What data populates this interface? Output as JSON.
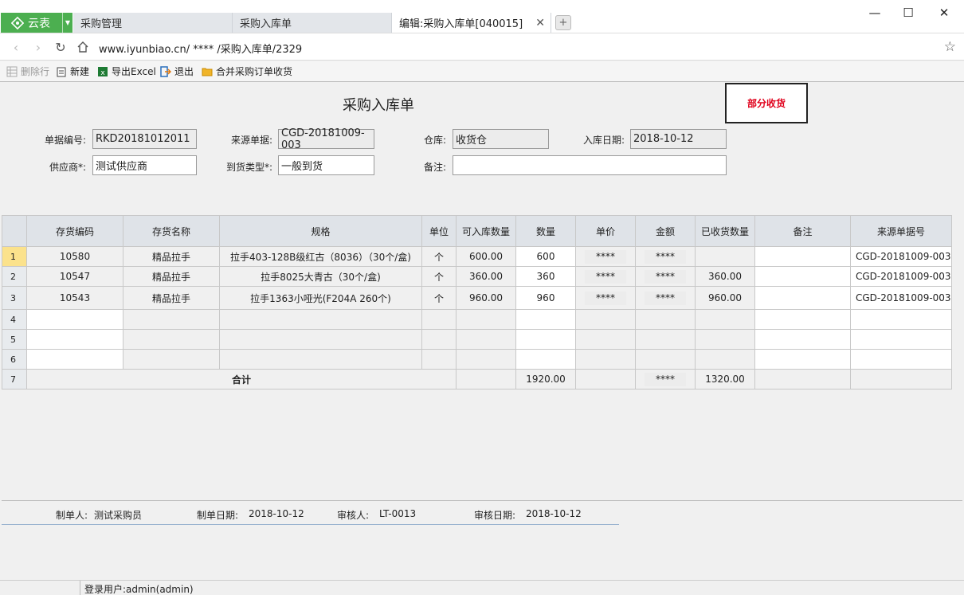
{
  "app": {
    "name": "云表"
  },
  "tabs": [
    {
      "label": "采购管理"
    },
    {
      "label": "采购入库单"
    },
    {
      "label": "编辑:采购入库单[040015]"
    }
  ],
  "window": {
    "min": "—",
    "max": "☐",
    "close": "✕"
  },
  "address": {
    "url": "www.iyunbiao.cn/ **** /采购入库单/2329"
  },
  "toolbar": {
    "delete_row": "删除行",
    "new": "新建",
    "export_excel": "导出Excel",
    "exit": "退出",
    "merge_receive": "合并采购订单收货"
  },
  "form": {
    "title": "采购入库单",
    "status": "部分收货",
    "doc_no_label": "单据编号:",
    "doc_no": "RKD20181012011",
    "source_label": "来源单据:",
    "source": "CGD-20181009-003",
    "warehouse_label": "仓库:",
    "warehouse": "收货仓",
    "date_label": "入库日期:",
    "date": "2018-10-12",
    "supplier_label": "供应商*:",
    "supplier": "测试供应商",
    "arrival_type_label": "到货类型*:",
    "arrival_type": "一般到货",
    "remark_label": "备注:",
    "remark": ""
  },
  "grid": {
    "headers": [
      "存货编码",
      "存货名称",
      "规格",
      "单位",
      "可入库数量",
      "数量",
      "单价",
      "金额",
      "已收货数量",
      "备注",
      "来源单据号"
    ],
    "rows": [
      {
        "n": "1",
        "code": "10580",
        "name": "精品拉手",
        "spec": "拉手403-128B级红古（8036）（30个/盒)",
        "unit": "个",
        "avail": "600.00",
        "qty": "600",
        "price": "****",
        "amount": "****",
        "received": "",
        "remark": "",
        "src": "CGD-20181009-003"
      },
      {
        "n": "2",
        "code": "10547",
        "name": "精品拉手",
        "spec": "拉手8025大青古（30个/盒)",
        "unit": "个",
        "avail": "360.00",
        "qty": "360",
        "price": "****",
        "amount": "****",
        "received": "360.00",
        "remark": "",
        "src": "CGD-20181009-003"
      },
      {
        "n": "3",
        "code": "10543",
        "name": "精品拉手",
        "spec": "拉手1363小哑光(F204A  260个)",
        "unit": "个",
        "avail": "960.00",
        "qty": "960",
        "price": "****",
        "amount": "****",
        "received": "960.00",
        "remark": "",
        "src": "CGD-20181009-003"
      }
    ],
    "empty_rows": [
      "4",
      "5",
      "6"
    ],
    "total": {
      "n": "7",
      "label": "合计",
      "qty": "1920.00",
      "amount": "****",
      "received": "1320.00"
    }
  },
  "footer": {
    "maker_label": "制单人:",
    "maker": "测试采购员",
    "make_date_label": "制单日期:",
    "make_date": "2018-10-12",
    "auditor_label": "审核人:",
    "auditor": "LT-0013",
    "audit_date_label": "审核日期:",
    "audit_date": "2018-10-12"
  },
  "status_bar": {
    "user": "登录用户:admin(admin)"
  }
}
